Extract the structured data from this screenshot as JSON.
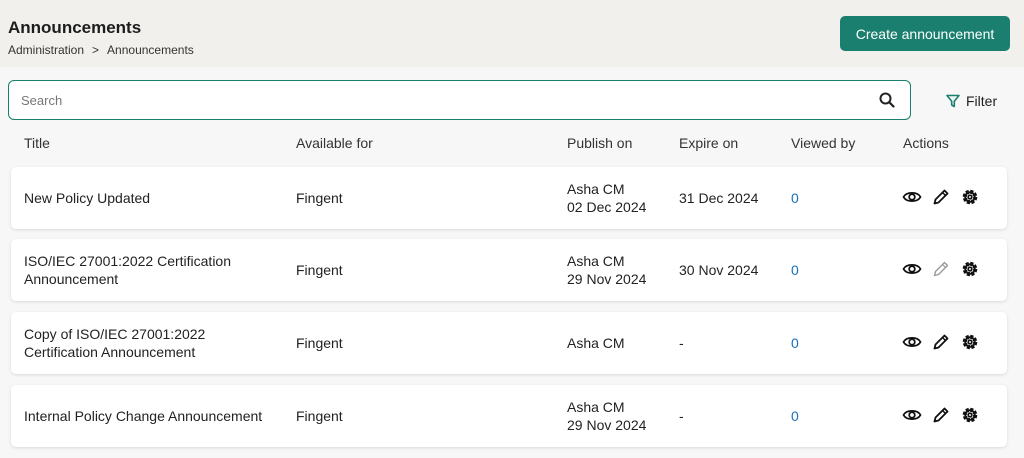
{
  "header": {
    "title": "Announcements",
    "breadcrumb": [
      "Administration",
      "Announcements"
    ],
    "breadcrumb_separator": ">",
    "create_button": "Create announcement"
  },
  "search": {
    "placeholder": "Search",
    "value": ""
  },
  "filter": {
    "label": "Filter"
  },
  "columns": {
    "title": "Title",
    "available_for": "Available for",
    "publish_on": "Publish on",
    "expire_on": "Expire on",
    "viewed_by": "Viewed by",
    "actions": "Actions"
  },
  "rows": [
    {
      "title": "New Policy Updated",
      "available_for": "Fingent",
      "publisher": "Asha CM",
      "publish_date": "02 Dec 2024",
      "expire_on": "31 Dec 2024",
      "viewed_by": "0",
      "edit_enabled": true
    },
    {
      "title": "ISO/IEC 27001:2022 Certification Announcement",
      "available_for": "Fingent",
      "publisher": "Asha CM",
      "publish_date": "29 Nov 2024",
      "expire_on": "30 Nov 2024",
      "viewed_by": "0",
      "edit_enabled": false
    },
    {
      "title": "Copy of ISO/IEC 27001:2022 Certification Announcement",
      "available_for": "Fingent",
      "publisher": "Asha CM",
      "publish_date": "",
      "expire_on": "-",
      "viewed_by": "0",
      "edit_enabled": true
    },
    {
      "title": "Internal Policy Change Announcement",
      "available_for": "Fingent",
      "publisher": "Asha CM",
      "publish_date": "29 Nov 2024",
      "expire_on": "-",
      "viewed_by": "0",
      "edit_enabled": true
    }
  ],
  "colors": {
    "accent": "#1a7f6e",
    "link": "#1a6fb8",
    "disabled_icon": "#999999"
  },
  "icons": {
    "search": "search-icon",
    "filter": "filter-icon",
    "view": "eye-icon",
    "edit": "pencil-icon",
    "settings": "gear-icon"
  }
}
